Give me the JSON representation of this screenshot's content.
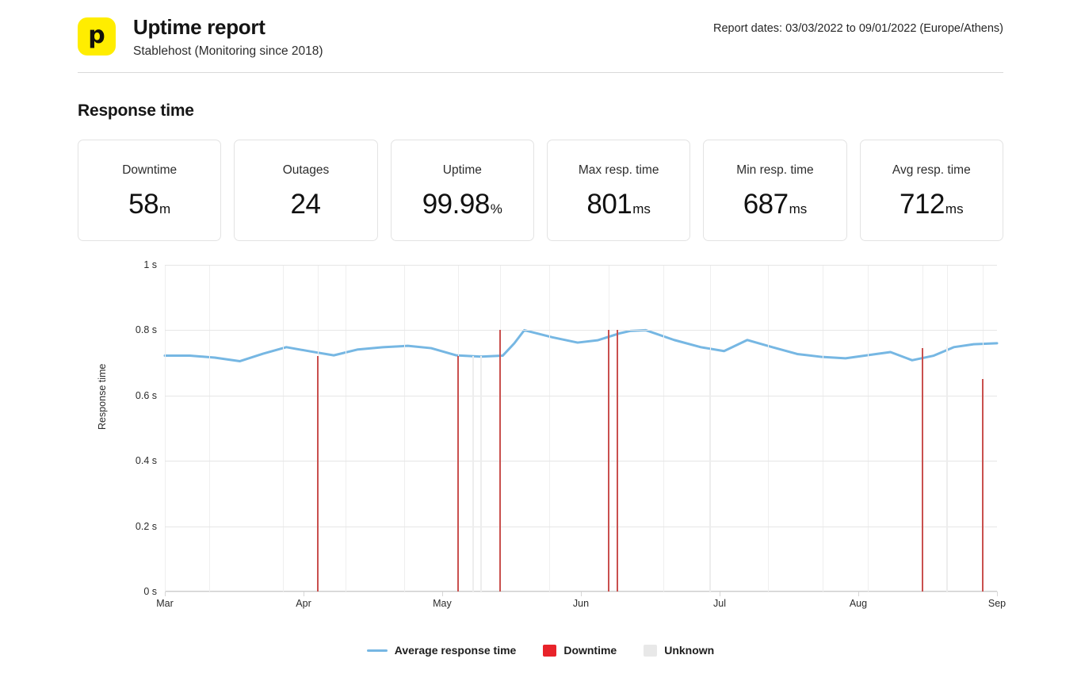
{
  "header": {
    "logo_glyph": "p",
    "title": "Uptime report",
    "subtitle": "Stablehost (Monitoring since 2018)",
    "report_dates": "Report dates: 03/03/2022 to 09/01/2022 (Europe/Athens)"
  },
  "section": {
    "title": "Response time"
  },
  "stats": [
    {
      "label": "Downtime",
      "value": "58",
      "unit": "m"
    },
    {
      "label": "Outages",
      "value": "24",
      "unit": ""
    },
    {
      "label": "Uptime",
      "value": "99.98",
      "unit": "%"
    },
    {
      "label": "Max resp. time",
      "value": "801",
      "unit": "ms"
    },
    {
      "label": "Min resp. time",
      "value": "687",
      "unit": "ms"
    },
    {
      "label": "Avg resp. time",
      "value": "712",
      "unit": "ms"
    }
  ],
  "legend": [
    {
      "label": "Average response time",
      "type": "line",
      "color": "#76b7e3"
    },
    {
      "label": "Downtime",
      "type": "square",
      "color": "#e8232a"
    },
    {
      "label": "Unknown",
      "type": "square",
      "color": "#e8e8e8"
    }
  ],
  "colors": {
    "brand_yellow": "#ffed00",
    "line_blue": "#76b7e3",
    "downtime_red": "#c9504e",
    "legend_red": "#e8232a",
    "unknown_gray": "#e8e8e8",
    "grid": "#e6e6e6"
  },
  "chart_data": {
    "type": "line",
    "title": "Response time",
    "xlabel": "",
    "ylabel": "Response time",
    "ylim": [
      0,
      1
    ],
    "y_unit": "s",
    "grid": true,
    "legend_position": "bottom-center",
    "yticks": [
      0,
      0.2,
      0.4,
      0.6,
      0.8,
      1
    ],
    "ytick_labels": [
      "0 s",
      "0.2 s",
      "0.4 s",
      "0.6 s",
      "0.8 s",
      "1 s"
    ],
    "xtick_labels": [
      "Mar",
      "Apr",
      "May",
      "Jun",
      "Jul",
      "Aug",
      "Sep"
    ],
    "xtick_positions": [
      0.0,
      0.1667,
      0.3333,
      0.5,
      0.6667,
      0.8333,
      1.0
    ],
    "series": [
      {
        "name": "Average response time",
        "color": "#76b7e3",
        "x": [
          0.0,
          0.033,
          0.066,
          0.099,
          0.132,
          0.165,
          0.198,
          0.231,
          0.264,
          0.297,
          0.33,
          0.363,
          0.396,
          0.429,
          0.462,
          0.495,
          0.528,
          0.561,
          0.594,
          0.627,
          0.66,
          0.693,
          0.726,
          0.759,
          0.792,
          0.825,
          0.858,
          0.891,
          0.924,
          0.957,
          0.99
        ],
        "values": [
          0.722,
          0.722,
          0.715,
          0.704,
          0.728,
          0.748,
          0.733,
          0.723,
          0.74,
          0.748,
          0.752,
          0.747,
          0.724,
          0.719,
          0.722,
          0.762,
          0.8,
          0.775,
          0.762,
          0.768,
          0.79,
          0.797,
          0.8,
          0.772,
          0.749,
          0.735,
          0.769,
          0.748,
          0.733,
          0.72,
          0.716
        ]
      },
      {
        "name": "Average response time (cont.)",
        "color": "#76b7e3",
        "x": [
          0.99,
          1.0
        ],
        "values": [
          0.716,
          0.762
        ]
      }
    ],
    "line_points": [
      [
        0.0,
        0.722
      ],
      [
        0.03,
        0.722
      ],
      [
        0.06,
        0.716
      ],
      [
        0.09,
        0.705
      ],
      [
        0.118,
        0.728
      ],
      [
        0.146,
        0.748
      ],
      [
        0.175,
        0.735
      ],
      [
        0.203,
        0.723
      ],
      [
        0.232,
        0.741
      ],
      [
        0.262,
        0.748
      ],
      [
        0.292,
        0.752
      ],
      [
        0.32,
        0.745
      ],
      [
        0.35,
        0.723
      ],
      [
        0.38,
        0.719
      ],
      [
        0.406,
        0.722
      ],
      [
        0.42,
        0.76
      ],
      [
        0.432,
        0.8
      ],
      [
        0.466,
        0.778
      ],
      [
        0.496,
        0.762
      ],
      [
        0.52,
        0.769
      ],
      [
        0.546,
        0.79
      ],
      [
        0.56,
        0.798
      ],
      [
        0.578,
        0.8
      ],
      [
        0.612,
        0.77
      ],
      [
        0.644,
        0.748
      ],
      [
        0.672,
        0.736
      ],
      [
        0.7,
        0.77
      ],
      [
        0.73,
        0.748
      ],
      [
        0.76,
        0.727
      ],
      [
        0.79,
        0.718
      ],
      [
        0.818,
        0.714
      ],
      [
        0.846,
        0.724
      ],
      [
        0.872,
        0.733
      ],
      [
        0.898,
        0.708
      ],
      [
        0.924,
        0.722
      ],
      [
        0.948,
        0.748
      ],
      [
        0.972,
        0.757
      ],
      [
        1.0,
        0.76
      ]
    ],
    "downtime_bars": [
      {
        "x": 0.1838,
        "top": 0.722
      },
      {
        "x": 0.3526,
        "top": 0.722
      },
      {
        "x": 0.403,
        "top": 0.8
      },
      {
        "x": 0.533,
        "top": 0.8
      },
      {
        "x": 0.544,
        "top": 0.8
      },
      {
        "x": 0.91,
        "top": 0.745
      },
      {
        "x": 0.983,
        "top": 0.65
      }
    ],
    "unknown_bars": [
      {
        "x": 0.37,
        "top": 0.722
      },
      {
        "x": 0.38,
        "top": 0.722
      },
      {
        "x": 0.655,
        "top": 0.74
      },
      {
        "x": 0.94,
        "top": 0.75
      }
    ],
    "vertical_gridlines": [
      0.0,
      0.053,
      0.142,
      0.1838,
      0.217,
      0.288,
      0.3526,
      0.403,
      0.462,
      0.533,
      0.599,
      0.655,
      0.725,
      0.79,
      0.845,
      0.91,
      0.94,
      0.983
    ],
    "annotations": {
      "downtime_total": "58m",
      "outages": "24",
      "uptime_pct": "99.98%",
      "max_resp_ms": "801ms",
      "min_resp_ms": "687ms",
      "avg_resp_ms": "712ms"
    }
  }
}
